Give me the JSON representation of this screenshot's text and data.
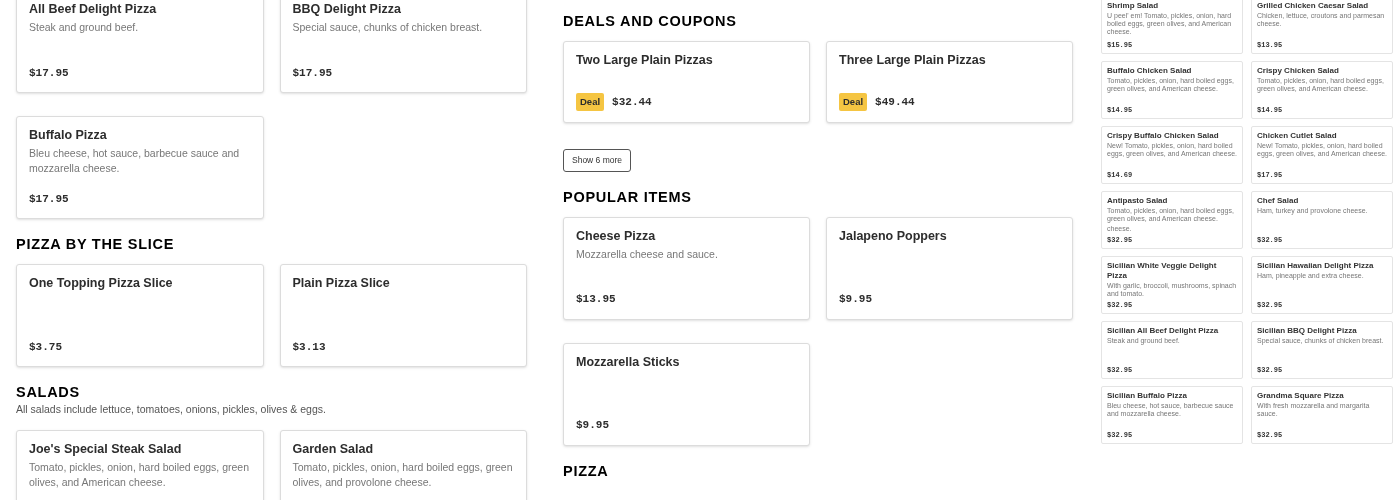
{
  "columns": [
    [
      {
        "kind": "cards",
        "items": [
          {
            "title": "All Beef Delight Pizza",
            "description": "Steak and ground beef.",
            "price": "$17.95"
          },
          {
            "title": "BBQ Delight Pizza",
            "description": "Special sauce, chunks of chicken breast.",
            "price": "$17.95"
          },
          {
            "title": "Buffalo Pizza",
            "description": "Bleu cheese, hot sauce, barbecue sauce and mozzarella cheese.",
            "price": "$17.95"
          }
        ]
      },
      {
        "kind": "heading",
        "title": "PIZZA BY THE SLICE"
      },
      {
        "kind": "cards",
        "items": [
          {
            "title": "One Topping Pizza Slice",
            "price": "$3.75"
          },
          {
            "title": "Plain Pizza Slice",
            "price": "$3.13"
          }
        ]
      },
      {
        "kind": "heading",
        "title": "SALADS",
        "subtitle": "All salads include lettuce, tomatoes, onions, pickles, olives & eggs."
      },
      {
        "kind": "cards",
        "items": [
          {
            "title": "Joe's Special Steak Salad",
            "description": "Tomato, pickles, onion, hard boiled eggs, green olives, and American cheese."
          },
          {
            "title": "Garden Salad",
            "description": "Tomato, pickles, onion, hard boiled eggs, green olives, and provolone cheese."
          }
        ]
      }
    ],
    [
      {
        "kind": "heading",
        "title": "DEALS AND COUPONS"
      },
      {
        "kind": "cards",
        "items": [
          {
            "title": "Two Large Plain Pizzas",
            "badge": "Deal",
            "price": "$32.44"
          },
          {
            "title": "Three Large Plain Pizzas",
            "badge": "Deal",
            "price": "$49.44"
          }
        ]
      },
      {
        "kind": "button",
        "label": "Show 6 more"
      },
      {
        "kind": "heading",
        "title": "POPULAR ITEMS"
      },
      {
        "kind": "cards",
        "items": [
          {
            "title": "Cheese Pizza",
            "description": "Mozzarella cheese and sauce.",
            "price": "$13.95"
          },
          {
            "title": "Jalapeno Poppers",
            "price": "$9.95"
          },
          {
            "title": "Mozzarella Sticks",
            "price": "$9.95"
          }
        ]
      },
      {
        "kind": "heading",
        "title": "PIZZA"
      }
    ],
    [
      {
        "kind": "mini_cards",
        "items": [
          {
            "title": "Shrimp Salad",
            "description": "U peel' em! Tomato, pickles, onion, hard boiled eggs, green olives, and American cheese.",
            "price": "$15.95"
          },
          {
            "title": "Grilled Chicken Caesar Salad",
            "description": "Chicken, lettuce, croutons and parmesan cheese.",
            "price": "$13.95"
          },
          {
            "title": "Buffalo Chicken Salad",
            "description": "Tomato, pickles, onion, hard boiled eggs, green olives, and American cheese.",
            "price": "$14.95"
          },
          {
            "title": "Crispy Chicken Salad",
            "description": "Tomato, pickles, onion, hard boiled eggs, green olives, and American cheese.",
            "price": "$14.95"
          },
          {
            "title": "Crispy Buffalo Chicken Salad",
            "description": "New! Tomato, pickles, onion, hard boiled eggs, green olives, and American cheese.",
            "price": "$14.69"
          },
          {
            "title": "Chicken Cutlet Salad",
            "description": "New! Tomato, pickles, onion, hard boiled eggs, green olives, and American cheese.",
            "price": "$17.95"
          },
          {
            "title": "Antipasto Salad",
            "description": "Tomato, pickles, onion, hard boiled eggs, green olives, and American cheese.",
            "extra": "cheese.",
            "price": "$32.95"
          },
          {
            "title": "Chef Salad",
            "description": "Ham, turkey and provolone cheese.",
            "price": "$32.95"
          },
          {
            "title": "Sicilian White Veggie Delight Pizza",
            "description": "With garlic, broccoli, mushrooms, spinach and tomato.",
            "price": "$32.95"
          },
          {
            "title": "Sicilian Hawaiian Delight Pizza",
            "description": "Ham, pineapple and extra cheese.",
            "price": "$32.95"
          },
          {
            "title": "Sicilian All Beef Delight Pizza",
            "description": "Steak and ground beef.",
            "price": "$32.95"
          },
          {
            "title": "Sicilian BBQ Delight Pizza",
            "description": "Special sauce, chunks of chicken breast.",
            "price": "$32.95"
          },
          {
            "title": "Sicilian Buffalo Pizza",
            "description": "Bleu cheese, hot sauce, barbecue sauce and mozzarella cheese.",
            "price": "$32.95"
          },
          {
            "title": "Grandma Square Pizza",
            "description": "With fresh mozzarella and margarita sauce.",
            "price": "$32.95"
          }
        ]
      }
    ]
  ]
}
